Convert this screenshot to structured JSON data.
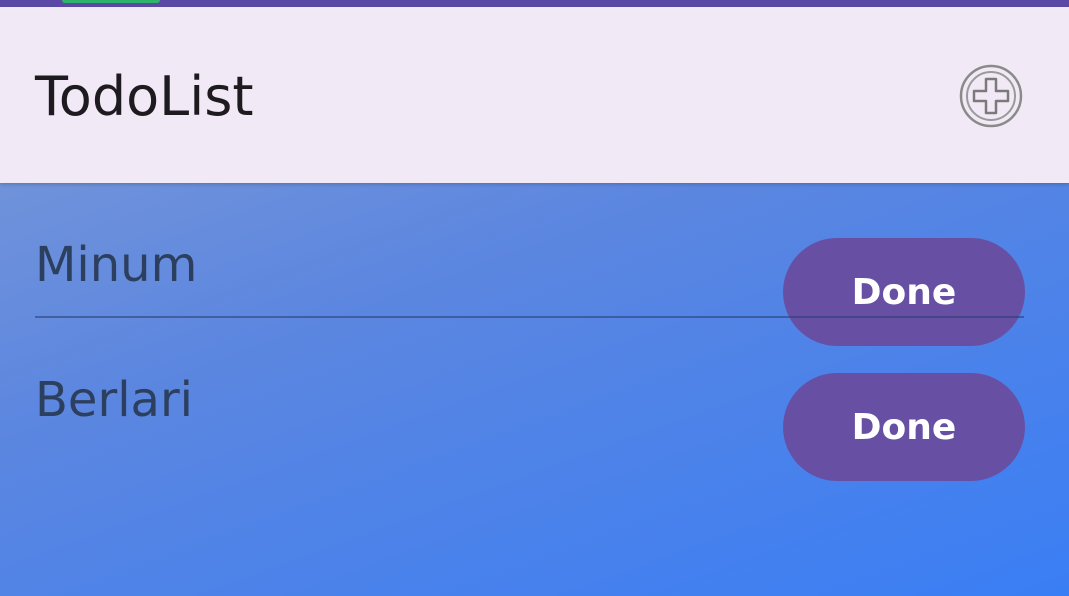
{
  "app": {
    "title": "TodoList",
    "add_icon": "add-circle-icon"
  },
  "todos": [
    {
      "label": "Minum",
      "action_label": "Done"
    },
    {
      "label": "Berlari",
      "action_label": "Done"
    }
  ],
  "colors": {
    "status_bar": "#5a4aa6",
    "app_bar": "#f1eaf6",
    "button": "#6750a4",
    "background_start": "#7f9bd6",
    "background_end": "#3a7ef5"
  }
}
